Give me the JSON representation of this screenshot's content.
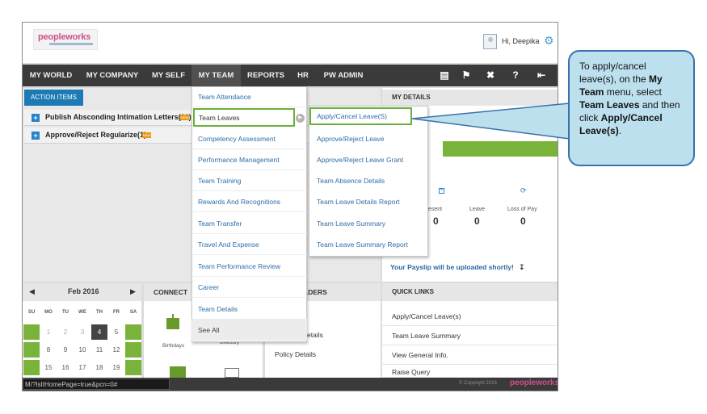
{
  "header": {
    "logo_text": "peopleworks",
    "greeting": "Hi, Deepika"
  },
  "nav": {
    "items": [
      "MY WORLD",
      "MY COMPANY",
      "MY SELF",
      "MY TEAM",
      "REPORTS",
      "HR",
      "PW ADMIN"
    ],
    "active": "MY TEAM",
    "right_icons": [
      "book-icon",
      "flag-icon",
      "tools-icon",
      "help-icon",
      "logout-icon"
    ]
  },
  "action_items": {
    "tab_label": "ACTION ITEMS",
    "rows": [
      {
        "label": "Publish Absconding Intimation Letters(21)",
        "badge": "NEW"
      },
      {
        "label": "Approve/Reject Regularize(1)",
        "badge": "NEW"
      }
    ]
  },
  "my_details": {
    "header": "MY DETAILS",
    "attendance_title": "ce",
    "labels": [
      "Present",
      "Leave",
      "Loss of Pay"
    ],
    "values": [
      "0",
      "0",
      "0"
    ],
    "payslip": "Your Payslip will be uploaded shortly!"
  },
  "calendar": {
    "month": "Feb 2016",
    "dow": [
      "SU",
      "MO",
      "TU",
      "WE",
      "TH",
      "FR",
      "SA"
    ],
    "rows": [
      [
        "",
        "1",
        "2",
        "3",
        "4",
        "5",
        ""
      ],
      [
        "",
        "8",
        "9",
        "10",
        "11",
        "12",
        ""
      ],
      [
        "",
        "15",
        "16",
        "17",
        "18",
        "19",
        ""
      ]
    ],
    "today": "4"
  },
  "connect": {
    "header": "CONNECT",
    "birthdays": "Birthdays",
    "directory": "Directory"
  },
  "third_panel": {
    "header": "LDERS",
    "details": "etails",
    "policy": "Policy Details"
  },
  "quick_links": {
    "header": "QUICK LINKS",
    "items": [
      "Apply/Cancel Leave(s)",
      "Team Leave Summary",
      "View General Info.",
      "Raise Query"
    ]
  },
  "my_team_menu": {
    "items": [
      "Team Attendance",
      "Team Leaves",
      "Competency Assessment",
      "Performance Management",
      "Team Training",
      "Rewards And Recognitions",
      "Team Transfer",
      "Travel And Expense",
      "Team Performance Review",
      "Career",
      "Team Details",
      "See All"
    ],
    "selected": "Team Leaves"
  },
  "team_leaves_submenu": {
    "items": [
      "Apply/Cancel Leave(S)",
      "Approve/Reject Leave",
      "Approve/Reject Leave Grant",
      "Team Absence Details",
      "Team Leave Details Report",
      "Team Leave Summary",
      "Team Leave Summary Report"
    ],
    "selected": "Apply/Cancel Leave(S)"
  },
  "footer": {
    "copyright": "© Copyright 2016",
    "logo_text": "peopleworks",
    "status_url": "M/?IsItHomePage=true&pcn=0#"
  },
  "callout": {
    "t1": "To apply/cancel leave(s), on the ",
    "b1": "My Team",
    "t2": " menu, select ",
    "b2": "Team Leaves",
    "t3": " and then click ",
    "b3": "Apply/Cancel Leave(s)",
    "t4": "."
  },
  "colors": {
    "nav_bg": "#3a3a3a",
    "accent_blue": "#1d7ab5",
    "highlight_green": "#6bb03a",
    "callout_bg": "#bde0ef"
  }
}
